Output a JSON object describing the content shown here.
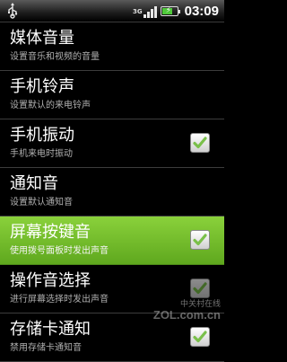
{
  "status_bar": {
    "network_label": "3G",
    "battery_level": 0.7,
    "time": "03:09"
  },
  "settings": [
    {
      "title": "媒体音量",
      "subtitle": "设置音乐和视频的音量",
      "has_checkbox": false
    },
    {
      "title": "手机铃声",
      "subtitle": "设置默认的来电铃声",
      "has_checkbox": false
    },
    {
      "title": "手机振动",
      "subtitle": "手机来电时振动",
      "has_checkbox": true,
      "checked": true
    },
    {
      "title": "通知音",
      "subtitle": "设置默认通知音",
      "has_checkbox": false
    },
    {
      "title": "屏幕按键音",
      "subtitle": "使用拨号面板时发出声音",
      "has_checkbox": true,
      "checked": true,
      "highlighted": true
    },
    {
      "title": "操作音选择",
      "subtitle": "进行屏幕选择时发出声音",
      "has_checkbox": true,
      "checked": true
    },
    {
      "title": "存储卡通知",
      "subtitle": "禁用存储卡通知音",
      "has_checkbox": true,
      "checked": true
    }
  ],
  "watermark": {
    "cn": "中关村在线",
    "en": "ZOL.com.cn"
  },
  "colors": {
    "highlight": "#7cc22e",
    "check": "#7ac04a"
  }
}
